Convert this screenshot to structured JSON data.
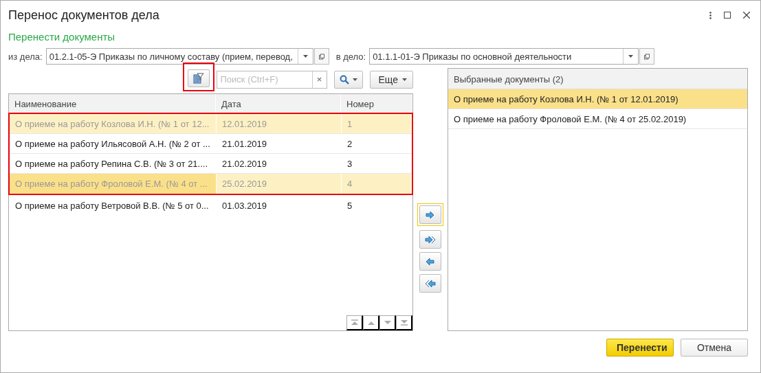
{
  "window": {
    "title": "Перенос документов дела"
  },
  "subtitle": "Перенести документы",
  "fields": [
    {
      "label": "из дела:",
      "value": "01.2.1-05-Э Приказы по личному составу (прием, перевод,"
    },
    {
      "label": "в дело:",
      "value": "01.1.1-01-Э Приказы по основной деятельности"
    }
  ],
  "toolbar": {
    "filter_highlighted": true,
    "search": {
      "placeholder": "Поиск (Ctrl+F)",
      "clear": "×"
    },
    "more": "Еще"
  },
  "table": {
    "columns": [
      "Наименование",
      "Дата",
      "Номер"
    ],
    "row_groups": [
      {
        "highlighted": true,
        "rows": [
          {
            "cells": [
              "О приеме на работу Козлова И.Н. (№ 1 от 12...",
              "12.01.2019",
              "1"
            ],
            "chosen": true,
            "selected": false
          },
          {
            "cells": [
              "О приеме на работу Ильясовой А.Н. (№ 2 от ...",
              "21.01.2019",
              "2"
            ],
            "chosen": false,
            "selected": false
          },
          {
            "cells": [
              "О приеме на работу Репина С.В. (№ 3 от 21....",
              "21.02.2019",
              "3"
            ],
            "chosen": false,
            "selected": false
          },
          {
            "cells": [
              "О приеме на работу Фроловой Е.М. (№ 4 от ...",
              "25.02.2019",
              "4"
            ],
            "chosen": true,
            "selected": true
          }
        ]
      },
      {
        "highlighted": false,
        "rows": [
          {
            "cells": [
              "О приеме на работу Ветровой В.В. (№ 5 от 0...",
              "01.03.2019",
              "5"
            ],
            "chosen": false,
            "selected": false
          }
        ]
      }
    ]
  },
  "move_buttons": [
    {
      "kind": "add",
      "focused": true
    },
    {
      "kind": "add_all",
      "focused": false
    },
    {
      "kind": "remove",
      "focused": false
    },
    {
      "kind": "remove_all",
      "focused": false
    }
  ],
  "selected_panel": {
    "title": "Выбранные документы (2)",
    "items": [
      {
        "label": "О приеме на работу Козлова И.Н. (№ 1 от 12.01.2019)",
        "selected": true
      },
      {
        "label": "О приеме на работу Фроловой Е.М. (№ 4 от 25.02.2019)",
        "selected": false
      }
    ]
  },
  "buttons": [
    {
      "label": "Перенести",
      "kind": "primary"
    },
    {
      "label": "Отмена",
      "kind": "secondary"
    }
  ]
}
